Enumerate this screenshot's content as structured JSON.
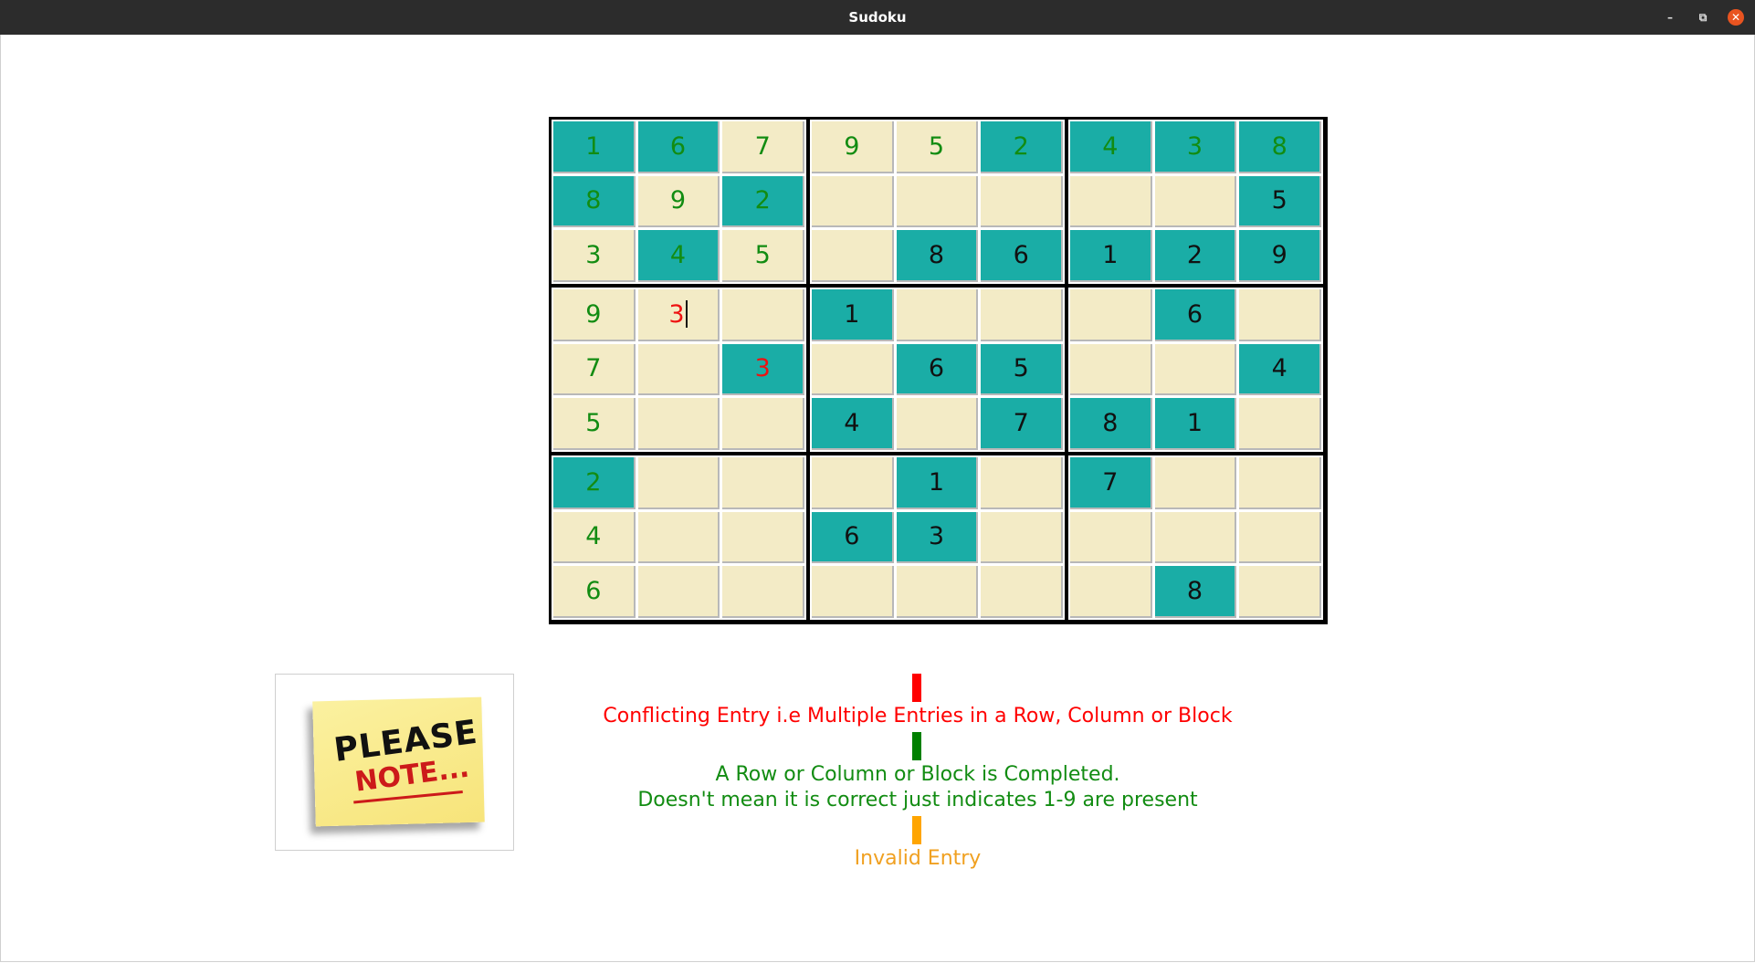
{
  "window": {
    "title": "Sudoku"
  },
  "colors": {
    "cell_given": "#1aada6",
    "cell_empty": "#f3ebc6",
    "digit_complete": "#128c12",
    "digit_normal": "#111111",
    "digit_conflict": "#ee1111",
    "legend_conflict": "#ff0000",
    "legend_complete": "#008000",
    "legend_invalid": "#ffa500"
  },
  "grid": [
    [
      {
        "v": "1",
        "bg": "teal",
        "fg": "g"
      },
      {
        "v": "6",
        "bg": "teal",
        "fg": "g"
      },
      {
        "v": "7",
        "bg": "beige",
        "fg": "g"
      },
      {
        "v": "9",
        "bg": "beige",
        "fg": "g"
      },
      {
        "v": "5",
        "bg": "beige",
        "fg": "g"
      },
      {
        "v": "2",
        "bg": "teal",
        "fg": "g"
      },
      {
        "v": "4",
        "bg": "teal",
        "fg": "g"
      },
      {
        "v": "3",
        "bg": "teal",
        "fg": "g"
      },
      {
        "v": "8",
        "bg": "teal",
        "fg": "g"
      }
    ],
    [
      {
        "v": "8",
        "bg": "teal",
        "fg": "g"
      },
      {
        "v": "9",
        "bg": "beige",
        "fg": "g"
      },
      {
        "v": "2",
        "bg": "teal",
        "fg": "g"
      },
      {
        "v": "",
        "bg": "beige",
        "fg": "k"
      },
      {
        "v": "",
        "bg": "beige",
        "fg": "k"
      },
      {
        "v": "",
        "bg": "beige",
        "fg": "k"
      },
      {
        "v": "",
        "bg": "beige",
        "fg": "k"
      },
      {
        "v": "",
        "bg": "beige",
        "fg": "k"
      },
      {
        "v": "5",
        "bg": "teal",
        "fg": "k"
      }
    ],
    [
      {
        "v": "3",
        "bg": "beige",
        "fg": "g"
      },
      {
        "v": "4",
        "bg": "teal",
        "fg": "g"
      },
      {
        "v": "5",
        "bg": "beige",
        "fg": "g"
      },
      {
        "v": "",
        "bg": "beige",
        "fg": "k"
      },
      {
        "v": "8",
        "bg": "teal",
        "fg": "k"
      },
      {
        "v": "6",
        "bg": "teal",
        "fg": "k"
      },
      {
        "v": "1",
        "bg": "teal",
        "fg": "k"
      },
      {
        "v": "2",
        "bg": "teal",
        "fg": "k"
      },
      {
        "v": "9",
        "bg": "teal",
        "fg": "k"
      }
    ],
    [
      {
        "v": "9",
        "bg": "beige",
        "fg": "g"
      },
      {
        "v": "3",
        "bg": "beige",
        "fg": "r",
        "caret": true
      },
      {
        "v": "",
        "bg": "beige",
        "fg": "k"
      },
      {
        "v": "1",
        "bg": "teal",
        "fg": "k"
      },
      {
        "v": "",
        "bg": "beige",
        "fg": "k"
      },
      {
        "v": "",
        "bg": "beige",
        "fg": "k"
      },
      {
        "v": "",
        "bg": "beige",
        "fg": "k"
      },
      {
        "v": "6",
        "bg": "teal",
        "fg": "k"
      },
      {
        "v": "",
        "bg": "beige",
        "fg": "k"
      }
    ],
    [
      {
        "v": "7",
        "bg": "beige",
        "fg": "g"
      },
      {
        "v": "",
        "bg": "beige",
        "fg": "k"
      },
      {
        "v": "3",
        "bg": "teal",
        "fg": "r"
      },
      {
        "v": "",
        "bg": "beige",
        "fg": "k"
      },
      {
        "v": "6",
        "bg": "teal",
        "fg": "k"
      },
      {
        "v": "5",
        "bg": "teal",
        "fg": "k"
      },
      {
        "v": "",
        "bg": "beige",
        "fg": "k"
      },
      {
        "v": "",
        "bg": "beige",
        "fg": "k"
      },
      {
        "v": "4",
        "bg": "teal",
        "fg": "k"
      }
    ],
    [
      {
        "v": "5",
        "bg": "beige",
        "fg": "g"
      },
      {
        "v": "",
        "bg": "beige",
        "fg": "k"
      },
      {
        "v": "",
        "bg": "beige",
        "fg": "k"
      },
      {
        "v": "4",
        "bg": "teal",
        "fg": "k"
      },
      {
        "v": "",
        "bg": "beige",
        "fg": "k"
      },
      {
        "v": "7",
        "bg": "teal",
        "fg": "k"
      },
      {
        "v": "8",
        "bg": "teal",
        "fg": "k"
      },
      {
        "v": "1",
        "bg": "teal",
        "fg": "k"
      },
      {
        "v": "",
        "bg": "beige",
        "fg": "k"
      }
    ],
    [
      {
        "v": "2",
        "bg": "teal",
        "fg": "g"
      },
      {
        "v": "",
        "bg": "beige",
        "fg": "k"
      },
      {
        "v": "",
        "bg": "beige",
        "fg": "k"
      },
      {
        "v": "",
        "bg": "beige",
        "fg": "k"
      },
      {
        "v": "1",
        "bg": "teal",
        "fg": "k"
      },
      {
        "v": "",
        "bg": "beige",
        "fg": "k"
      },
      {
        "v": "7",
        "bg": "teal",
        "fg": "k"
      },
      {
        "v": "",
        "bg": "beige",
        "fg": "k"
      },
      {
        "v": "",
        "bg": "beige",
        "fg": "k"
      }
    ],
    [
      {
        "v": "4",
        "bg": "beige",
        "fg": "g"
      },
      {
        "v": "",
        "bg": "beige",
        "fg": "k"
      },
      {
        "v": "",
        "bg": "beige",
        "fg": "k"
      },
      {
        "v": "6",
        "bg": "teal",
        "fg": "k"
      },
      {
        "v": "3",
        "bg": "teal",
        "fg": "k"
      },
      {
        "v": "",
        "bg": "beige",
        "fg": "k"
      },
      {
        "v": "",
        "bg": "beige",
        "fg": "k"
      },
      {
        "v": "",
        "bg": "beige",
        "fg": "k"
      },
      {
        "v": "",
        "bg": "beige",
        "fg": "k"
      }
    ],
    [
      {
        "v": "6",
        "bg": "beige",
        "fg": "g"
      },
      {
        "v": "",
        "bg": "beige",
        "fg": "k"
      },
      {
        "v": "",
        "bg": "beige",
        "fg": "k"
      },
      {
        "v": "",
        "bg": "beige",
        "fg": "k"
      },
      {
        "v": "",
        "bg": "beige",
        "fg": "k"
      },
      {
        "v": "",
        "bg": "beige",
        "fg": "k"
      },
      {
        "v": "",
        "bg": "beige",
        "fg": "k"
      },
      {
        "v": "8",
        "bg": "teal",
        "fg": "k"
      },
      {
        "v": "",
        "bg": "beige",
        "fg": "k"
      }
    ]
  ],
  "note": {
    "line1": "PLEASE",
    "line2": "NOTE..."
  },
  "legend": {
    "conflict": "Conflicting Entry i.e Multiple Entries in a Row, Column or Block",
    "complete_line1": "A Row or Column or Block is Completed.",
    "complete_line2": "Doesn't mean it is correct just indicates 1-9 are present",
    "invalid": "Invalid Entry"
  }
}
